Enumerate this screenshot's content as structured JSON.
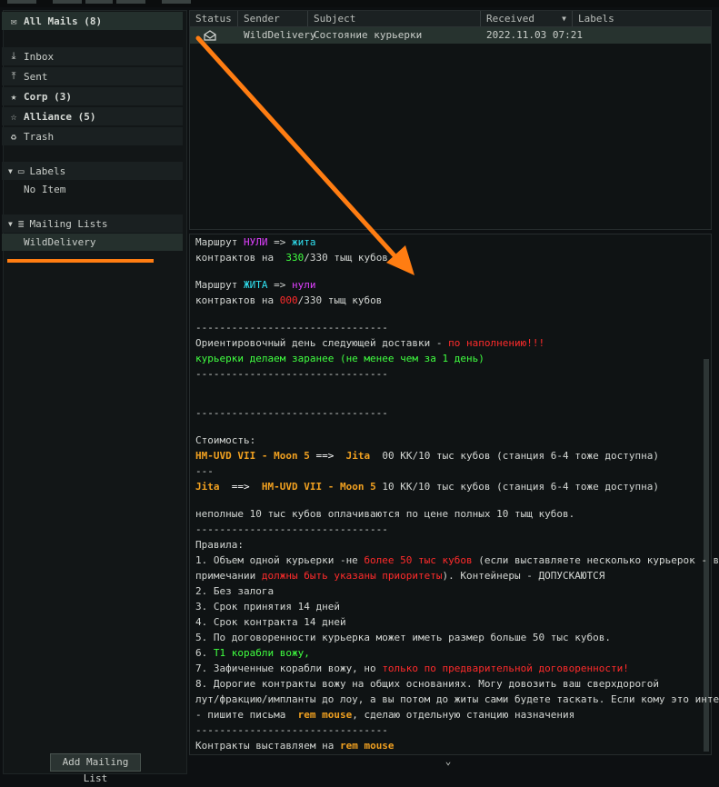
{
  "sidebar": {
    "all_mails": {
      "label": "All Mails",
      "count": "(8)"
    },
    "folders": [
      {
        "label": "Inbox",
        "count": ""
      },
      {
        "label": "Sent",
        "count": ""
      },
      {
        "label": "Corp",
        "count": "(3)"
      },
      {
        "label": "Alliance",
        "count": "(5)"
      },
      {
        "label": "Trash",
        "count": ""
      }
    ],
    "labels_section": {
      "label": "Labels",
      "empty_text": "No Item"
    },
    "mailing_lists_section": {
      "label": "Mailing Lists",
      "items": [
        "WildDelivery"
      ]
    },
    "add_mailing_list_button": "Add Mailing List"
  },
  "mail_list": {
    "columns": [
      "Status",
      "Sender",
      "Subject",
      "Received",
      "Labels"
    ],
    "rows": [
      {
        "status_icon": "envelope-open-icon",
        "sender": "WildDelivery",
        "subject": "Состояние курьерки",
        "received": "2022.11.03 07:21",
        "labels": ""
      }
    ]
  },
  "mail_body": {
    "l1a": "Маршрут ",
    "l1b": "НУЛИ",
    "l1c": " => ",
    "l1d": "жита",
    "l2a": "контрактов на  ",
    "l2b": "330",
    "l2c": "/330 тыщ кубов",
    "l3a": "Маршрут ",
    "l3b": "ЖИТА",
    "l3c": " => ",
    "l3d": "нули",
    "l4a": "контрактов на ",
    "l4b": "000",
    "l4c": "/330 тыщ кубов",
    "sep": "--------------------------------",
    "l5a": "Ориентировочный день следующей доставки - ",
    "l5b": "по наполнению!!!",
    "l6": "курьерки делаем заранее (не менее чем за 1 день)",
    "cost_title": "Стоимость:",
    "r1a": "HM-UVD VII - Moon 5",
    "r1b": " ==>  ",
    "r1c": "Jita",
    "r1d": "  00 КК/10 тыс кубов (станция 6-4 тоже доступна)",
    "dash3": "---",
    "r2a": "Jita",
    "r2b": "  ==>  ",
    "r2c": "HM-UVD VII - Moon 5",
    "r2d": " 10 КК/10 тыс кубов (станция 6-4 тоже доступна)",
    "partial": "неполные 10 тыс кубов оплачиваются по цене полных 10 тыщ кубов.",
    "rules_title": "Правила:",
    "p1a": "1. Объем одной курьерки -не ",
    "p1b": "более 50 тыс кубов",
    "p1c": " (если выставляете несколько курьерок - в",
    "p1d": "примечании ",
    "p1e": "должны быть указаны приоритеты",
    "p1f": "). Контейнеры - ДОПУСКАЮТСЯ",
    "p2": "2. Без залога",
    "p3": "3. Срок принятия 14 дней",
    "p4": "4. Срок контракта 14 дней",
    "p5": "5. По договоренности курьерка может иметь размер больше 50 тыс кубов.",
    "p6a": "6. ",
    "p6b": "Т1 корабли вожу,",
    "p7a": "7. Зафиченные корабли вожу, но ",
    "p7b": "только по предварительной договоренности!",
    "p8a": "8. Дорогие контракты вожу на общих основаниях. Могу довозить ваш сверхдорогой",
    "p8b": "лут/фракцию/импланты до лоу, а вы потом до житы сами будете таскать. Если кому это интересно",
    "p8c": "- пишите письма  ",
    "p8d": "rem mouse",
    "p8e": ", сделаю отдельную станцию назначения",
    "last_a": "Контракты выставляем на ",
    "last_b": "rem mouse"
  },
  "colors": {
    "annotation": "#ff7d12",
    "magenta": "#e040ff",
    "cyan": "#30e0f0",
    "green": "#40ff40",
    "red": "#ff2b2b",
    "orange": "#f0a020"
  }
}
